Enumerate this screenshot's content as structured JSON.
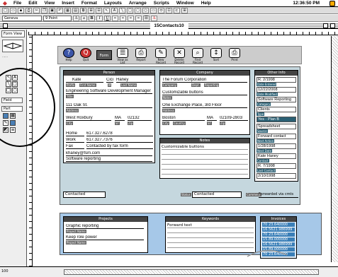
{
  "menubar": {
    "items": [
      "File",
      "Edit",
      "View",
      "Insert",
      "Format",
      "Layouts",
      "Arrange",
      "Scripts",
      "Window",
      "Help"
    ],
    "clock": "12:36:50 PM"
  },
  "format_bar": {
    "font": "Geneva",
    "size": "9 Point",
    "bold": "B",
    "italic": "I",
    "underline": "U"
  },
  "window": {
    "title": "15Contacts10"
  },
  "tool_panel": {
    "layout_label": "Form View",
    "field_label": "Field",
    "part_label": "Part"
  },
  "nav": {
    "buttons": [
      {
        "label": "Help",
        "icon": "?"
      },
      {
        "label": "Quit",
        "icon": "Q"
      },
      {
        "label": "Form",
        "icon": "▤"
      },
      {
        "label": "View as List",
        "icon": "☰"
      },
      {
        "label": "Report",
        "icon": "⎙"
      },
      {
        "label": "New Record",
        "icon": "✎"
      },
      {
        "label": "Delete Record",
        "icon": "✕"
      },
      {
        "label": "Find Record",
        "icon": "⌕"
      },
      {
        "label": "Sort",
        "icon": "↕"
      },
      {
        "label": "Print",
        "icon": "⎙"
      }
    ]
  },
  "person": {
    "header": "Person",
    "prefix": "",
    "first": "Kate",
    "middle": "Cici",
    "last": "Haney",
    "labels": {
      "prefix": "Prefix",
      "first": "First Name",
      "middle": "M",
      "last": "Last Name"
    },
    "title": "Engineering Software Development Manager",
    "title_label": "Title",
    "addr1": "111 Oak St.",
    "addr_label": "Address",
    "city": "West Roxbury",
    "state": "MA",
    "zip": "02132",
    "city_label": "City",
    "state_label": "ST",
    "zip_label": "Zip",
    "home_phone_label": "Home",
    "home_phone": "617.327.6278",
    "work_phone_label": "Work",
    "work_phone": "617.327.7376",
    "fax_label": "Fax",
    "fax": "Contacted by fax form",
    "email": "khaney@fsm.com",
    "email_label": "Email",
    "email2": "Software reporting",
    "email2_label": "Email 2"
  },
  "company": {
    "header": "Company",
    "name": "The Forum Corporation",
    "name_label": "Company",
    "dept_label": "Dept.",
    "dept": "Reporting",
    "contact": "Customizable buttons",
    "contact_label": "Notes",
    "addr1": "One Exchange Place, 3rd Floor",
    "addr_label": "Address",
    "city": "Boston",
    "state": "MA",
    "zip": "02109-2803",
    "city_label": "City",
    "country_label": "Country",
    "state_label": "ST",
    "zip_label": "Zip"
  },
  "notes_panel": {
    "header": "Notes",
    "text": "Customizable buttons"
  },
  "other": {
    "header": "Other Info",
    "rows": [
      {
        "value": "R. 2/1998",
        "tag": "Date Entered"
      },
      {
        "value": "12/22/2008",
        "tag": "Date Modified"
      },
      {
        "value": "Software Reporting",
        "tag": "Category"
      },
      {
        "value": "Clients",
        "tag": "Type"
      },
      {
        "value": "Yes - Plan B",
        "tag": "Status"
      },
      {
        "value": "Spreadsheet",
        "tag": "Source"
      },
      {
        "value": "Forward contact",
        "tag": "Next Action"
      },
      {
        "value": "1/28/1998",
        "tag": "Next Date"
      },
      {
        "value": "Kate Haney",
        "tag": "Contact"
      },
      {
        "value": "R. 7/1998",
        "tag": "Last Contact"
      },
      {
        "value": "Follow-up",
        "tag": "Action"
      },
      {
        "value": "2/10/1998",
        "tag": "Due Date"
      }
    ]
  },
  "status_row": {
    "left": "Contacted",
    "status_tag": "Status",
    "status": "Contacted",
    "right_tag": "Comment",
    "right": "Forwarded via cmts"
  },
  "bottom": {
    "projects_header": "Projects",
    "projects": [
      {
        "value": "Graphic reporting",
        "tag": "Project Name"
      },
      {
        "value": "Keep role power",
        "tag": "Project Name"
      }
    ],
    "keywords_header": "Keywords",
    "keyword": "Forward text",
    "invoices_header": "Invoices",
    "invoices": [
      "70  23.640000",
      "16.5621.986999",
      "70  23.640000",
      "15.89.000000",
      "16.5621.986999",
      "15.89.000000",
      "70  23.640000",
      "15.89.000000"
    ]
  },
  "footer": {
    "page": "100"
  },
  "colors": {
    "teal": "#2a5f73",
    "dark_header": "#444444",
    "hatch": "#dce8ec",
    "bottom_bg": "#a6c8e8"
  }
}
